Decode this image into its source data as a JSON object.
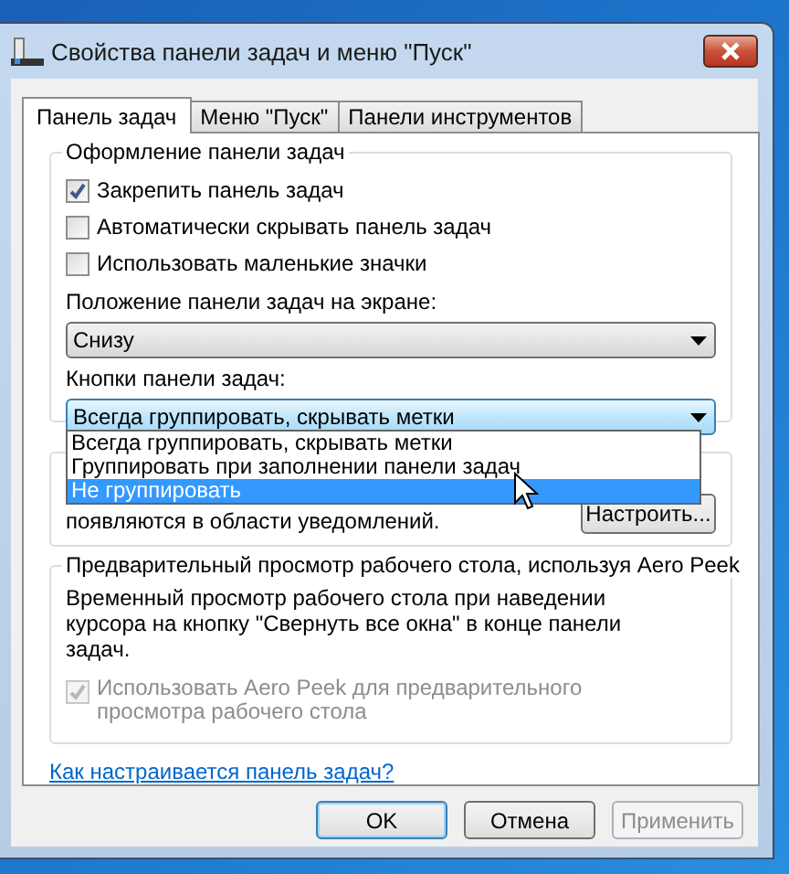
{
  "window": {
    "title": "Свойства панели задач и меню \"Пуск\""
  },
  "tabs": [
    {
      "label": "Панель задач",
      "selected": true
    },
    {
      "label": "Меню \"Пуск\"",
      "selected": false
    },
    {
      "label": "Панели инструментов",
      "selected": false
    }
  ],
  "appearance_group": {
    "title": "Оформление панели задач",
    "checkboxes": [
      {
        "label": "Закрепить панель задач",
        "checked": true
      },
      {
        "label": "Автоматически скрывать панель задач",
        "checked": false
      },
      {
        "label": "Использовать маленькие значки",
        "checked": false
      }
    ],
    "position_label": "Положение панели задач на экране:",
    "position_select": {
      "value": "Снизу"
    },
    "buttons_label": "Кнопки панели задач:",
    "buttons_select": {
      "value": "Всегда группировать, скрывать метки",
      "open": true,
      "options": [
        {
          "label": "Всегда группировать, скрывать метки",
          "highlighted": false
        },
        {
          "label": "Группировать при заполнении панели задач",
          "highlighted": false
        },
        {
          "label": "Не группировать",
          "highlighted": true
        }
      ]
    }
  },
  "notification_group": {
    "text": "появляются в области уведомлений.",
    "button": "Настроить..."
  },
  "peek_group": {
    "title": "Предварительный просмотр рабочего стола, используя Aero Peek",
    "description": "Временный просмотр рабочего стола при наведении курсора на кнопку \"Свернуть все окна\" в конце панели задач.",
    "checkbox": {
      "label": "Использовать Aero Peek для предварительного просмотра рабочего стола",
      "checked": true,
      "disabled": true
    }
  },
  "help_link": "Как настраивается панель задач?",
  "buttons": [
    {
      "label": "OK",
      "default": true,
      "disabled": false
    },
    {
      "label": "Отмена",
      "default": false,
      "disabled": false
    },
    {
      "label": "Применить",
      "default": false,
      "disabled": true
    }
  ]
}
